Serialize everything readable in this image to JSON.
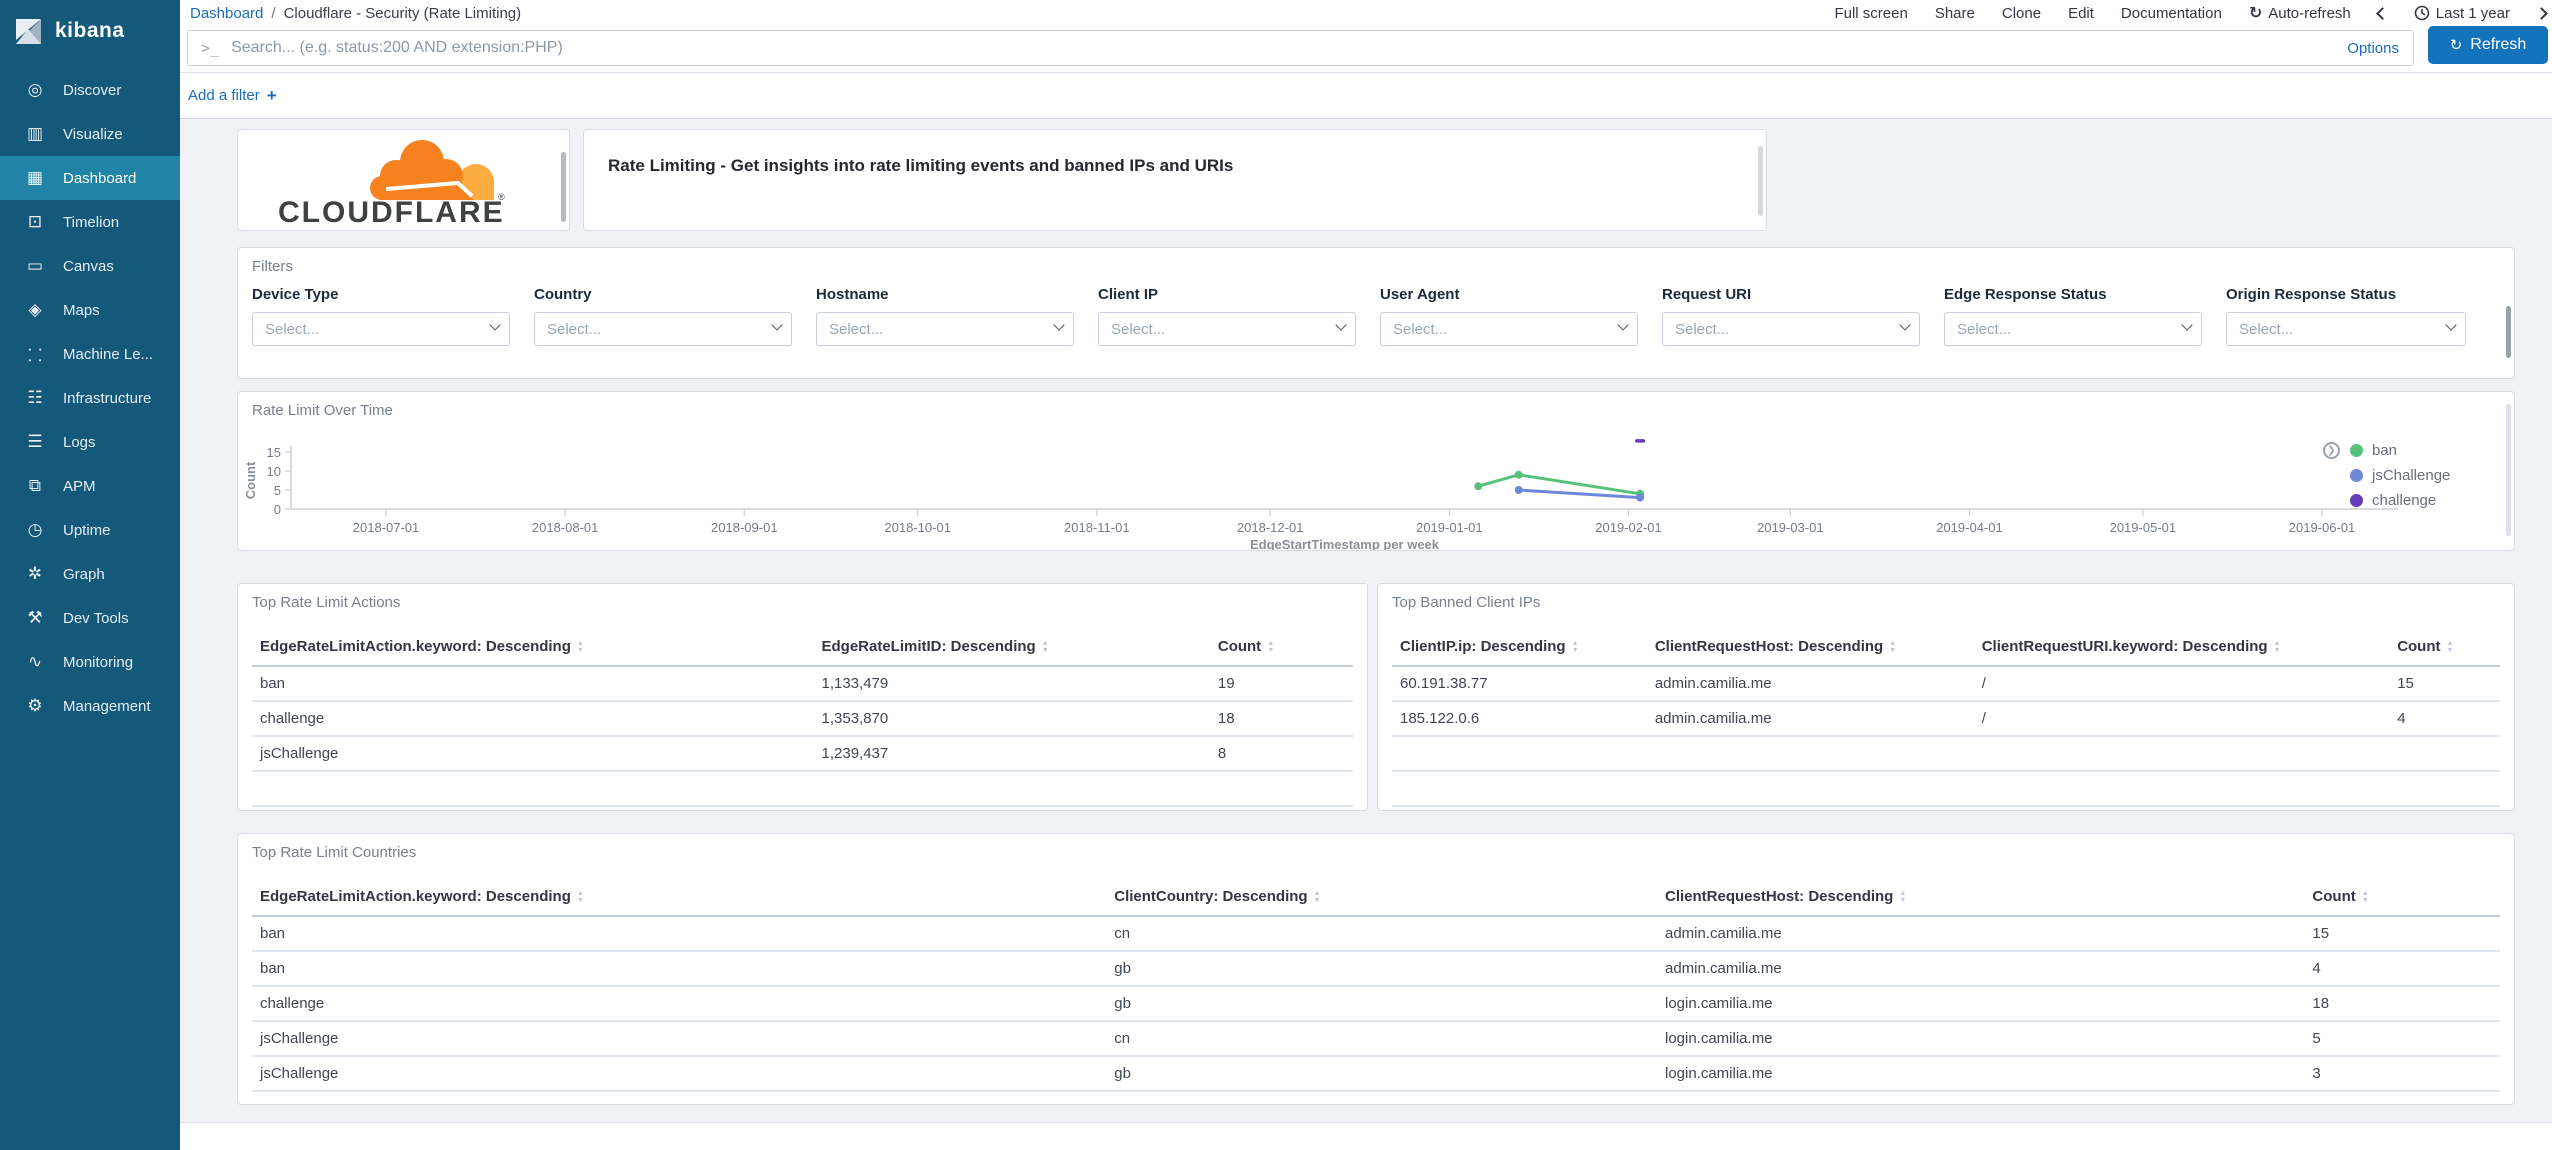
{
  "app": {
    "name": "kibana"
  },
  "colors": {
    "sidebar_bg": "#14587a",
    "sidebar_active_bg": "#2184a6",
    "link_blue": "#1a6dbb",
    "refresh_button_bg": "#1374bd",
    "panel_border": "#d6dce6",
    "content_bg": "#f0f2f5",
    "cloudflare_orange": "#f6821f",
    "cloudflare_light_orange": "#fbad41",
    "series_green": "#57c17b",
    "series_blue": "#6f87d8",
    "series_purple": "#663db8"
  },
  "sidebar": {
    "logo_text": "kibana",
    "items": [
      {
        "slug": "discover",
        "label": "Discover",
        "icon": "◎",
        "active": false
      },
      {
        "slug": "visualize",
        "label": "Visualize",
        "icon": "▥",
        "active": false
      },
      {
        "slug": "dashboard",
        "label": "Dashboard",
        "icon": "▦",
        "active": true
      },
      {
        "slug": "timelion",
        "label": "Timelion",
        "icon": "⊡",
        "active": false
      },
      {
        "slug": "canvas",
        "label": "Canvas",
        "icon": "▭",
        "active": false
      },
      {
        "slug": "maps",
        "label": "Maps",
        "icon": "◈",
        "active": false
      },
      {
        "slug": "machine-learning",
        "label": "Machine Le...",
        "icon": "⸬",
        "active": false
      },
      {
        "slug": "infrastructure",
        "label": "Infrastructure",
        "icon": "☷",
        "active": false
      },
      {
        "slug": "logs",
        "label": "Logs",
        "icon": "☰",
        "active": false
      },
      {
        "slug": "apm",
        "label": "APM",
        "icon": "⧉",
        "active": false
      },
      {
        "slug": "uptime",
        "label": "Uptime",
        "icon": "◷",
        "active": false
      },
      {
        "slug": "graph",
        "label": "Graph",
        "icon": "✲",
        "active": false
      },
      {
        "slug": "dev-tools",
        "label": "Dev Tools",
        "icon": "⚒",
        "active": false
      },
      {
        "slug": "monitoring",
        "label": "Monitoring",
        "icon": "∿",
        "active": false
      },
      {
        "slug": "management",
        "label": "Management",
        "icon": "⚙",
        "active": false
      }
    ]
  },
  "topbar": {
    "breadcrumb": {
      "link": "Dashboard",
      "separator": "/",
      "current": "Cloudflare - Security (Rate Limiting)"
    },
    "menu": {
      "full_screen": "Full screen",
      "share": "Share",
      "clone": "Clone",
      "edit": "Edit",
      "documentation": "Documentation",
      "auto_refresh": "Auto-refresh",
      "auto_refresh_icon": "↻",
      "time_range": "Last 1 year"
    }
  },
  "searchbar": {
    "prompt_icon": ">_",
    "placeholder": "Search... (e.g. status:200 AND extension:PHP)",
    "value": "",
    "options_label": "Options",
    "refresh_label": "Refresh",
    "refresh_icon": "↻"
  },
  "filter_bar": {
    "add_filter_label": "Add a filter",
    "plus": "+"
  },
  "panels": {
    "logo": {
      "brand": "CLOUDFLARE",
      "registered_mark": "®"
    },
    "description": {
      "text": "Rate Limiting - Get insights into rate limiting events and banned IPs and URIs"
    },
    "filters": {
      "title": "Filters",
      "fields": [
        {
          "slug": "device-type",
          "label": "Device Type",
          "placeholder": "Select..."
        },
        {
          "slug": "country",
          "label": "Country",
          "placeholder": "Select..."
        },
        {
          "slug": "hostname",
          "label": "Hostname",
          "placeholder": "Select..."
        },
        {
          "slug": "client-ip",
          "label": "Client IP",
          "placeholder": "Select..."
        },
        {
          "slug": "user-agent",
          "label": "User Agent",
          "placeholder": "Select..."
        },
        {
          "slug": "request-uri",
          "label": "Request URI",
          "placeholder": "Select..."
        },
        {
          "slug": "edge-response-status",
          "label": "Edge Response Status",
          "placeholder": "Select..."
        },
        {
          "slug": "origin-response-status",
          "label": "Origin Response Status",
          "placeholder": "Select..."
        }
      ]
    },
    "tables": [
      {
        "slug": "top-rate-limit-actions",
        "title": "Top Rate Limit Actions",
        "headers": [
          "EdgeRateLimitAction.keyword: Descending",
          "EdgeRateLimitID: Descending",
          "Count"
        ],
        "col_widths": [
          "51%",
          "36%",
          "13%"
        ],
        "rows": [
          [
            "ban",
            "1,133,479",
            "19"
          ],
          [
            "challenge",
            "1,353,870",
            "18"
          ],
          [
            "jsChallenge",
            "1,239,437",
            "8"
          ]
        ],
        "empty_rows": 1
      },
      {
        "slug": "top-banned-client-ips",
        "title": "Top Banned Client IPs",
        "headers": [
          "ClientIP.ip: Descending",
          "ClientRequestHost: Descending",
          "ClientRequestURI.keyword: Descending",
          "Count"
        ],
        "col_widths": [
          "23%",
          "29.5%",
          "37.5%",
          "10%"
        ],
        "rows": [
          [
            "60.191.38.77",
            "admin.camilia.me",
            "/",
            "15"
          ],
          [
            "185.122.0.6",
            "admin.camilia.me",
            "/",
            "4"
          ]
        ],
        "empty_rows": 2
      },
      {
        "slug": "top-rate-limit-countries",
        "title": "Top Rate Limit Countries",
        "headers": [
          "EdgeRateLimitAction.keyword: Descending",
          "ClientCountry: Descending",
          "ClientRequestHost: Descending",
          "Count"
        ],
        "col_widths": [
          "38%",
          "24.5%",
          "28.8%",
          "8.7%"
        ],
        "rows": [
          [
            "ban",
            "cn",
            "admin.camilia.me",
            "15"
          ],
          [
            "ban",
            "gb",
            "admin.camilia.me",
            "4"
          ],
          [
            "challenge",
            "gb",
            "login.camilia.me",
            "18"
          ],
          [
            "jsChallenge",
            "cn",
            "login.camilia.me",
            "5"
          ],
          [
            "jsChallenge",
            "gb",
            "login.camilia.me",
            "3"
          ]
        ],
        "empty_rows": 0
      }
    ]
  },
  "chart_data": {
    "type": "line",
    "title": "Rate Limit Over Time",
    "xlabel": "EdgeStartTimestamp per week",
    "ylabel": "Count",
    "ylim": [
      0,
      15
    ],
    "yticks": [
      0,
      5,
      10,
      15
    ],
    "xticks": [
      "2018-07-01",
      "2018-08-01",
      "2018-09-01",
      "2018-10-01",
      "2018-11-01",
      "2018-12-01",
      "2019-01-01",
      "2019-02-01",
      "2019-03-01",
      "2019-04-01",
      "2019-05-01",
      "2019-06-01"
    ],
    "grid": false,
    "legend_position": "right",
    "series": [
      {
        "name": "ban",
        "color": "#57c17b",
        "points": [
          [
            "2019-01-06",
            6
          ],
          [
            "2019-01-13",
            9
          ],
          [
            "2019-02-03",
            4
          ]
        ]
      },
      {
        "name": "jsChallenge",
        "color": "#6f87d8",
        "points": [
          [
            "2019-01-13",
            5
          ],
          [
            "2019-02-03",
            3
          ]
        ]
      },
      {
        "name": "challenge",
        "color": "#663db8",
        "points": [
          [
            "2019-02-03",
            18
          ]
        ]
      }
    ]
  }
}
